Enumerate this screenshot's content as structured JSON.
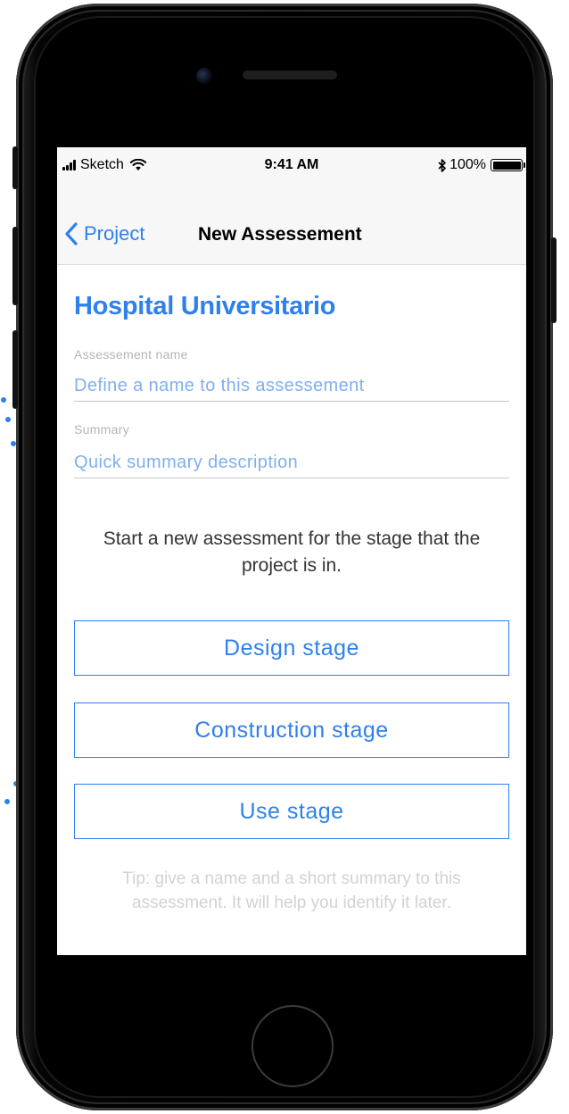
{
  "status_bar": {
    "carrier": "Sketch",
    "time": "9:41 AM",
    "battery": "100%",
    "icons": [
      "signal-bars-icon",
      "wifi-icon",
      "bluetooth-icon",
      "battery-icon"
    ]
  },
  "nav": {
    "back_label": "Project",
    "title": "New Assessement"
  },
  "form": {
    "project_title": "Hospital Universitario",
    "name_label": "Assessement name",
    "name_placeholder": "Define a name to this assessement",
    "name_value": "",
    "summary_label": "Summary",
    "summary_placeholder": "Quick summary description",
    "summary_value": ""
  },
  "intro": "Start a new assessment for the stage that the project is in.",
  "stages": [
    {
      "label": "Design stage"
    },
    {
      "label": "Construction stage"
    },
    {
      "label": "Use stage"
    }
  ],
  "tip": "Tip: give a name and a short summary to this assessment. It will help you identify it later.",
  "colors": {
    "accent": "#2f80ed",
    "placeholder": "#7fb0ee",
    "label": "#b4b4b4",
    "tip": "#d2d2d2",
    "phone_body": "#000000"
  }
}
